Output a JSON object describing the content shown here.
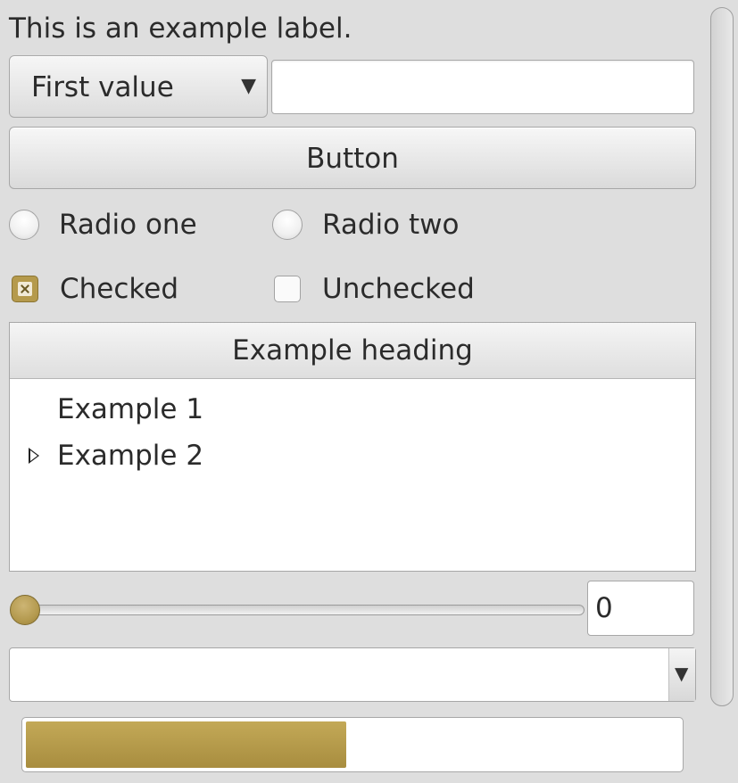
{
  "label": "This is an example label.",
  "combo": {
    "value": "First value",
    "arrow": "▼",
    "icon": "dropdown-arrow-icon"
  },
  "line_edit": {
    "value": ""
  },
  "button": {
    "label": "Button"
  },
  "radios": [
    {
      "label": "Radio one",
      "checked": false
    },
    {
      "label": "Radio two",
      "checked": false
    }
  ],
  "checkboxes": [
    {
      "label": "Checked",
      "checked": true
    },
    {
      "label": "Unchecked",
      "checked": false
    }
  ],
  "tree": {
    "heading": "Example heading",
    "items": [
      {
        "label": "Example 1",
        "expandable": false
      },
      {
        "label": "Example 2",
        "expandable": true
      }
    ]
  },
  "slider": {
    "value": 0
  },
  "spinbox": {
    "value": "0"
  },
  "combo2": {
    "value": "",
    "arrow": "▼"
  },
  "progress": {
    "fraction": 0.49
  },
  "colors": {
    "accent": "#b59a4c",
    "background": "#dedede"
  }
}
